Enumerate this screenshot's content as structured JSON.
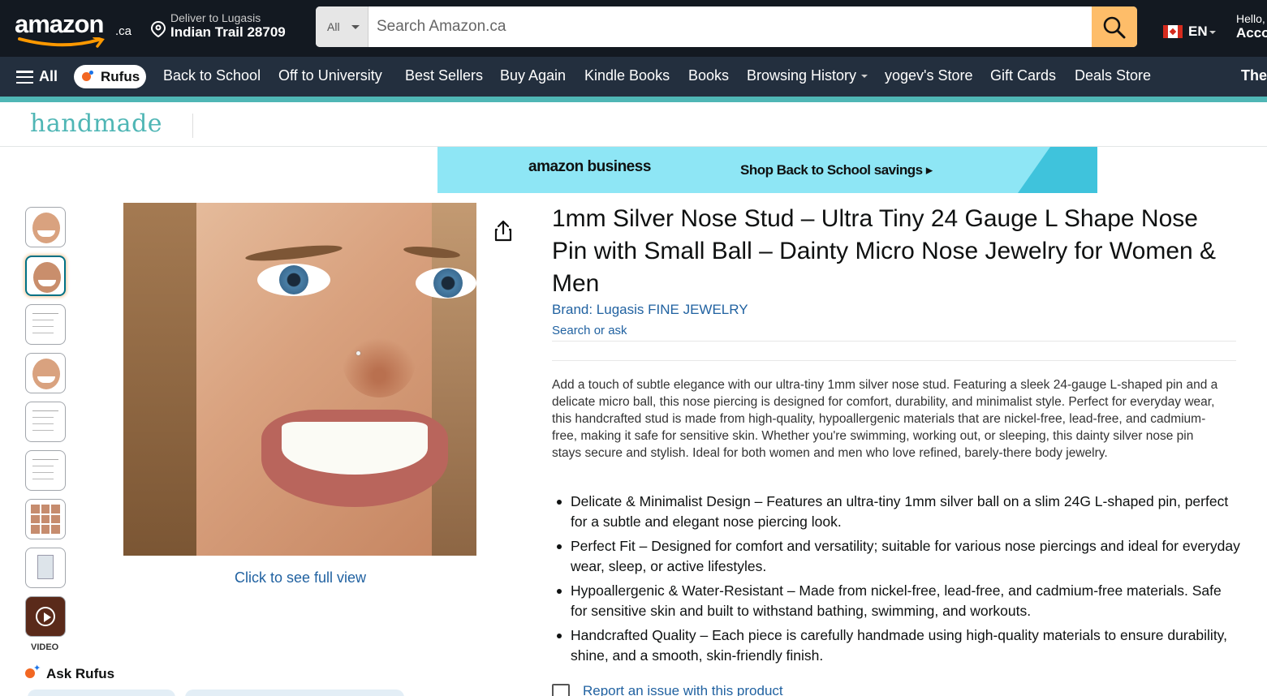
{
  "header": {
    "logo_text": "amazon",
    "logo_suffix": ".ca",
    "deliver_line1": "Deliver to Lugasis",
    "deliver_line2": "Indian Trail 28709",
    "search_category": "All",
    "search_placeholder": "Search Amazon.ca",
    "language": "EN",
    "account_line1": "Hello, L",
    "account_line2": "Account"
  },
  "nav": {
    "all_label": "All",
    "rufus_label": "Rufus",
    "links": [
      "Back to School",
      "Off to University",
      "Best Sellers",
      "Buy Again",
      "Kindle Books",
      "Books",
      "Browsing History",
      "yogev's Store",
      "Gift Cards",
      "Deals Store",
      "The"
    ]
  },
  "store_header": {
    "name": "handmade"
  },
  "banner": {
    "brand": "amazon business",
    "cta": "Shop Back to School savings ▸"
  },
  "gallery": {
    "video_label": "VIDEO",
    "ask_rufus": "Ask Rufus",
    "full_view": "Click to see full view"
  },
  "product": {
    "title": "1mm Silver Nose Stud – Ultra Tiny 24 Gauge L Shape Nose Pin with Small Ball – Dainty Micro Nose Jewelry for Women & Men",
    "brand": "Brand: Lugasis FINE JEWELRY",
    "search_or_ask": "Search or ask",
    "description": "Add a touch of subtle elegance with our ultra-tiny 1mm silver nose stud. Featuring a sleek 24-gauge L-shaped pin and a delicate micro ball, this nose piercing is designed for comfort, durability, and minimalist style. Perfect for everyday wear, this handcrafted stud is made from high-quality, hypoallergenic materials that are nickel-free, lead-free, and cadmium-free, making it safe for sensitive skin. Whether you're swimming, working out, or sleeping, this dainty silver nose pin stays secure and stylish. Ideal for both women and men who love refined, barely-there body jewelry.",
    "bullets": [
      "Delicate & Minimalist Design – Features an ultra-tiny 1mm silver ball on a slim 24G L-shaped pin, perfect for a subtle and elegant nose piercing look.",
      "Perfect Fit – Designed for comfort and versatility; suitable for various nose piercings and ideal for everyday wear, sleep, or active lifestyles.",
      "Hypoallergenic & Water-Resistant – Made from nickel-free, lead-free, and cadmium-free materials. Safe for sensitive skin and built to withstand bathing, swimming, and workouts.",
      "Handcrafted Quality – Each piece is carefully handmade using high-quality materials to ensure durability, shine, and a smooth, skin-friendly finish."
    ],
    "report_link": "Report an issue with this product"
  },
  "colors": {
    "nav_dark": "#131921",
    "nav_mid": "#232f3e",
    "accent": "#febd69",
    "handmade_teal": "#4fb6b5",
    "link": "#2162a1"
  }
}
